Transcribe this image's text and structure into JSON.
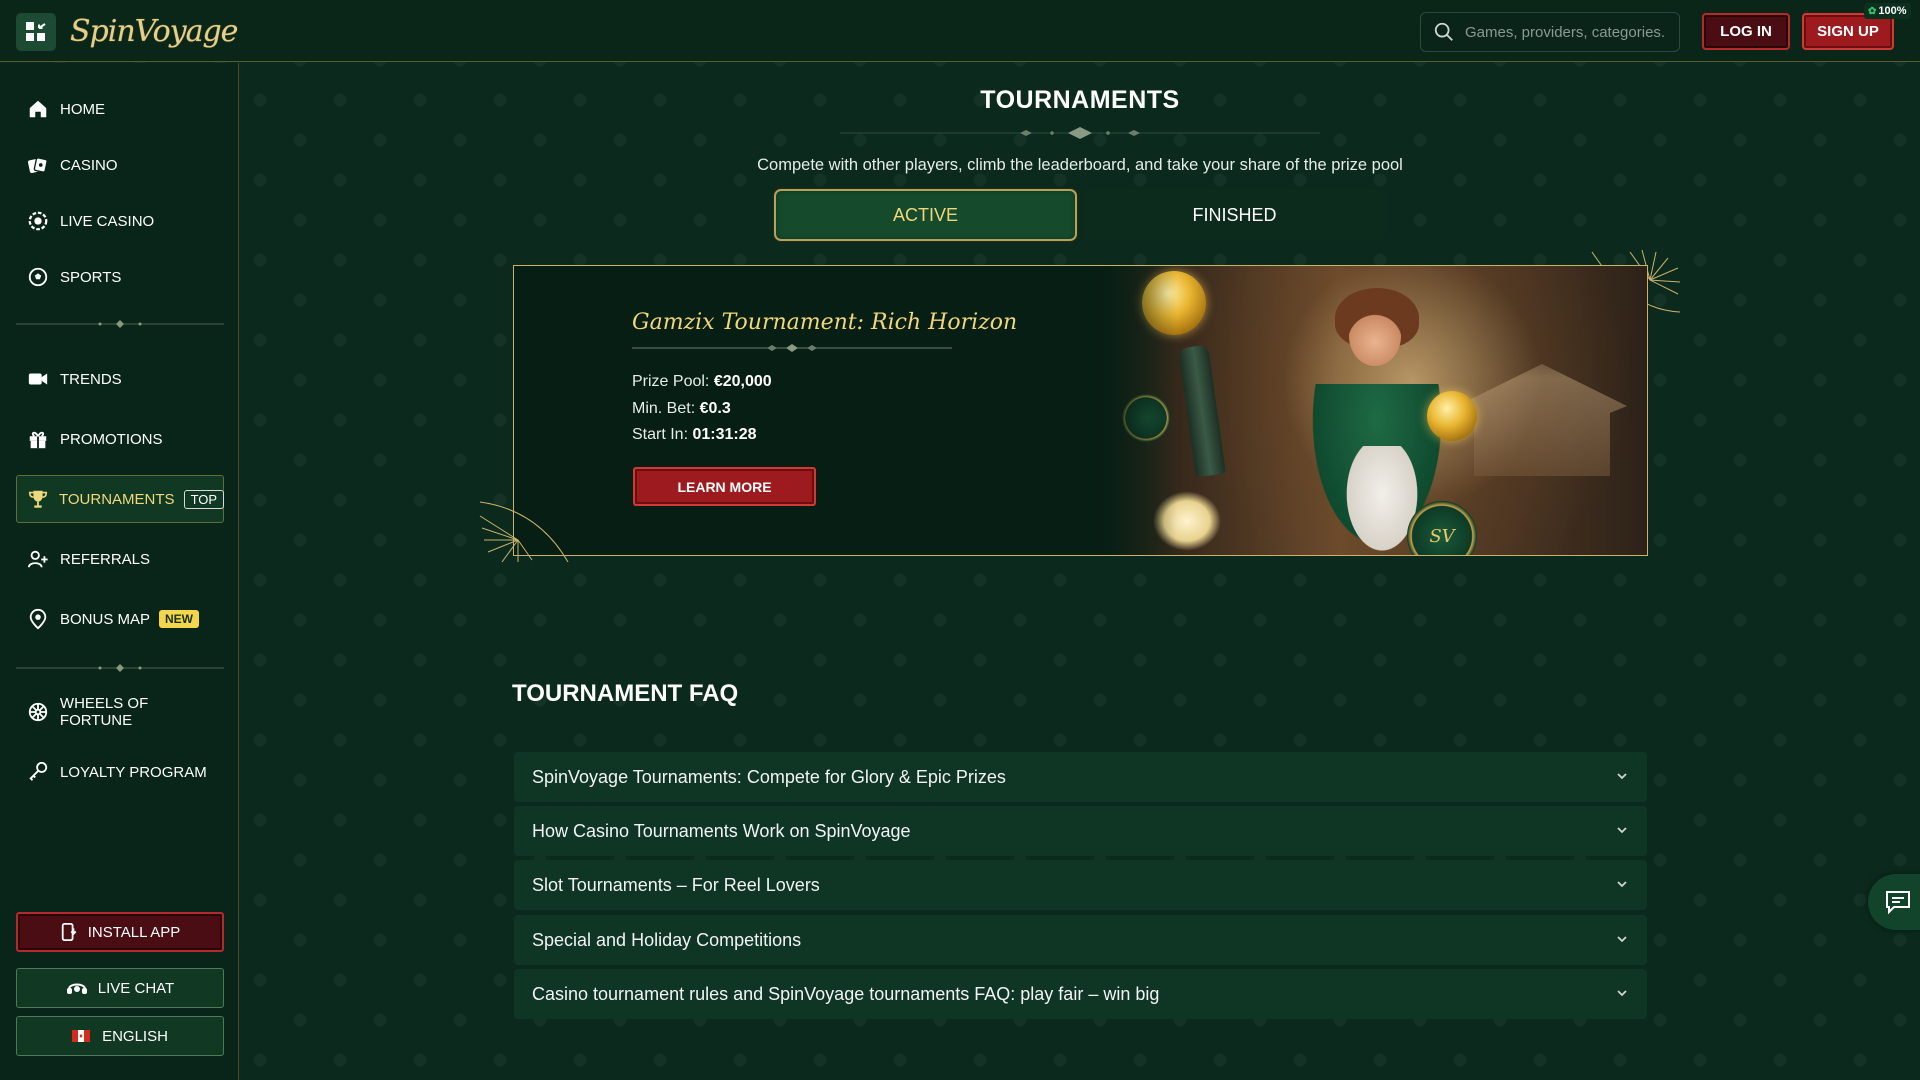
{
  "header": {
    "logo": "SpinVoyage",
    "search_placeholder": "Games, providers, categories...",
    "login_label": "LOG IN",
    "signup_label": "SIGN UP",
    "battery": "100%"
  },
  "sidebar": {
    "items": [
      {
        "label": "HOME",
        "icon": "home-icon"
      },
      {
        "label": "CASINO",
        "icon": "casino-icon"
      },
      {
        "label": "LIVE CASINO",
        "icon": "live-casino-icon"
      },
      {
        "label": "SPORTS",
        "icon": "sports-icon"
      },
      {
        "label": "TRENDS",
        "icon": "trends-icon"
      },
      {
        "label": "PROMOTIONS",
        "icon": "gift-icon"
      },
      {
        "label": "TOURNAMENTS",
        "icon": "trophy-icon",
        "badge": "TOP"
      },
      {
        "label": "REFERRALS",
        "icon": "referrals-icon"
      },
      {
        "label": "BONUS MAP",
        "icon": "map-pin-icon",
        "badge": "NEW"
      },
      {
        "label": "WHEELS OF FORTUNE",
        "icon": "wheel-icon"
      },
      {
        "label": "LOYALTY PROGRAM",
        "icon": "loyalty-icon"
      }
    ],
    "install_label": "INSTALL APP",
    "live_chat_label": "LIVE CHAT",
    "language_label": "ENGLISH"
  },
  "main": {
    "title": "TOURNAMENTS",
    "subtitle": "Compete with other players, climb the leaderboard, and take your share of the prize pool",
    "tabs": [
      {
        "label": "ACTIVE",
        "active": true
      },
      {
        "label": "FINISHED",
        "active": false
      }
    ],
    "tournament": {
      "name": "Gamzix Tournament: Rich Horizon",
      "prize_label": "Prize Pool:",
      "prize_value": "€20,000",
      "minbet_label": "Min. Bet:",
      "minbet_value": "€0.3",
      "start_label": "Start In:",
      "start_value": "01:31:28",
      "button_label": "LEARN MORE",
      "chip_text": "SV"
    },
    "faq_title": "TOURNAMENT FAQ",
    "faq": [
      "SpinVoyage Tournaments: Compete for Glory & Epic Prizes",
      "How Casino Tournaments Work on SpinVoyage",
      "Slot Tournaments – For Reel Lovers",
      "Special and Holiday Competitions",
      "Casino tournament rules and SpinVoyage tournaments FAQ: play fair – win big"
    ]
  },
  "colors": {
    "background": "#0b2a1d",
    "gold": "#f1d67a",
    "red_button": "#9d1b1f",
    "active_tab": "#154b2c"
  }
}
